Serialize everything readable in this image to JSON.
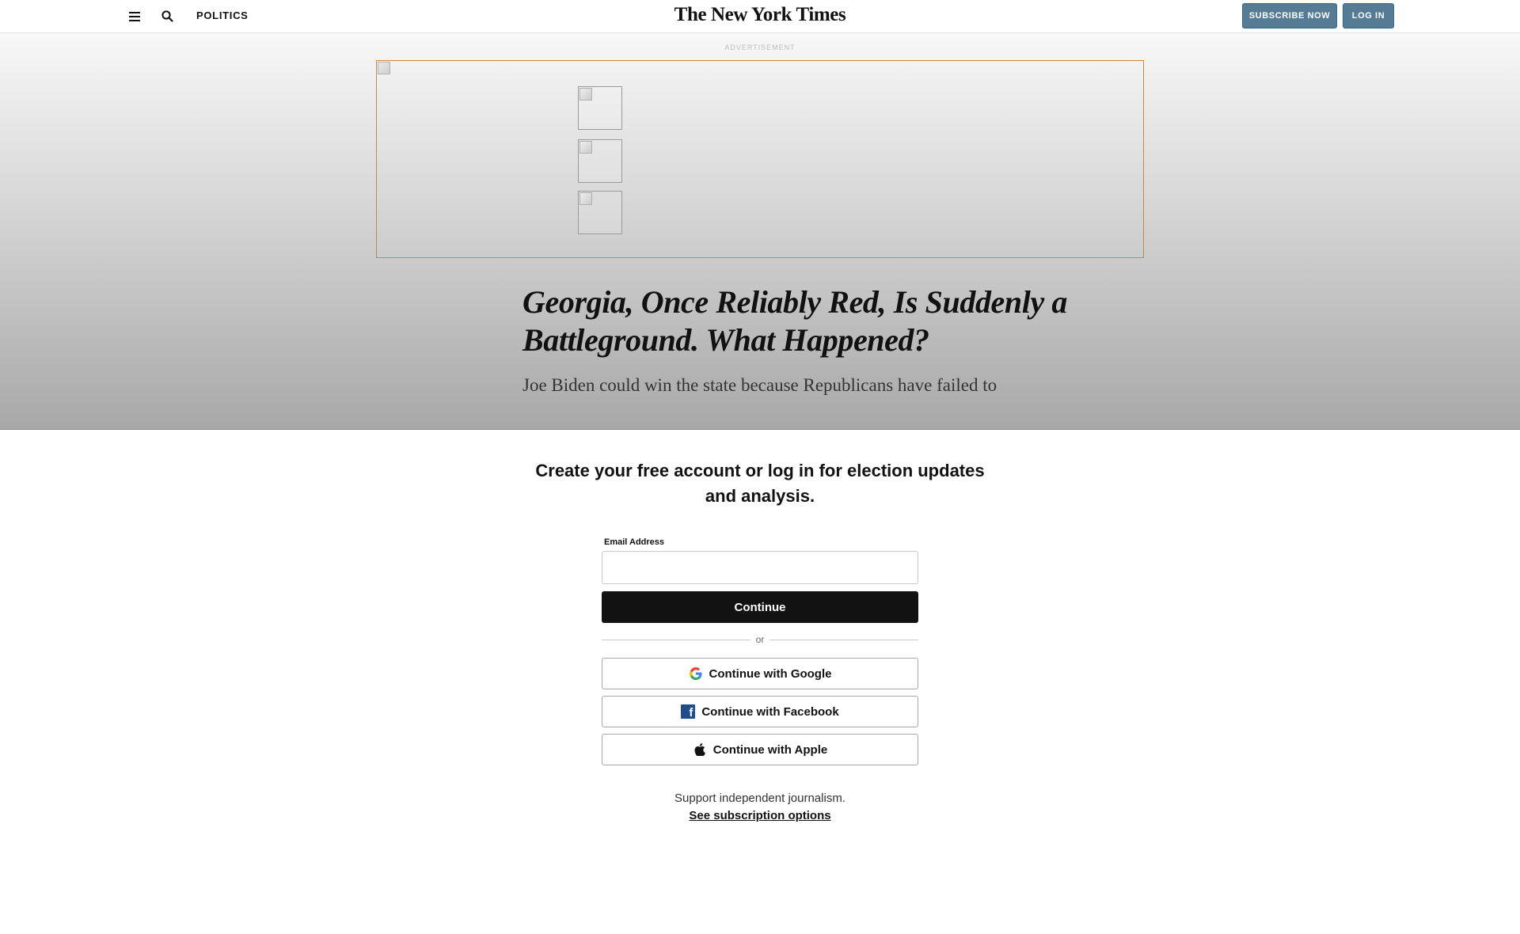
{
  "header": {
    "menu_icon": "hamburger-menu-icon",
    "search_icon": "search-icon",
    "section_label": "POLITICS",
    "masthead": "The New York Times",
    "subscribe_label": "SUBSCRIBE NOW",
    "login_label": "LOG IN",
    "button_color": "#567b95"
  },
  "ad": {
    "label": "ADVERTISEMENT",
    "border_color": "#c8893f"
  },
  "article": {
    "headline": "Georgia, Once Reliably Red, Is Suddenly a Battleground. What Happened?",
    "summary": "Joe Biden could win the state because Republicans have failed to"
  },
  "registration": {
    "title": "Create your free account or log in for election updates and analysis.",
    "email_label": "Email Address",
    "email_value": "",
    "continue_label": "Continue",
    "divider_text": "or",
    "google_label": "Continue with Google",
    "facebook_label": "Continue with Facebook",
    "apple_label": "Continue with Apple",
    "support_text": "Support independent journalism.",
    "subscription_link": "See subscription options",
    "facebook_color": "#1f4d8a"
  }
}
